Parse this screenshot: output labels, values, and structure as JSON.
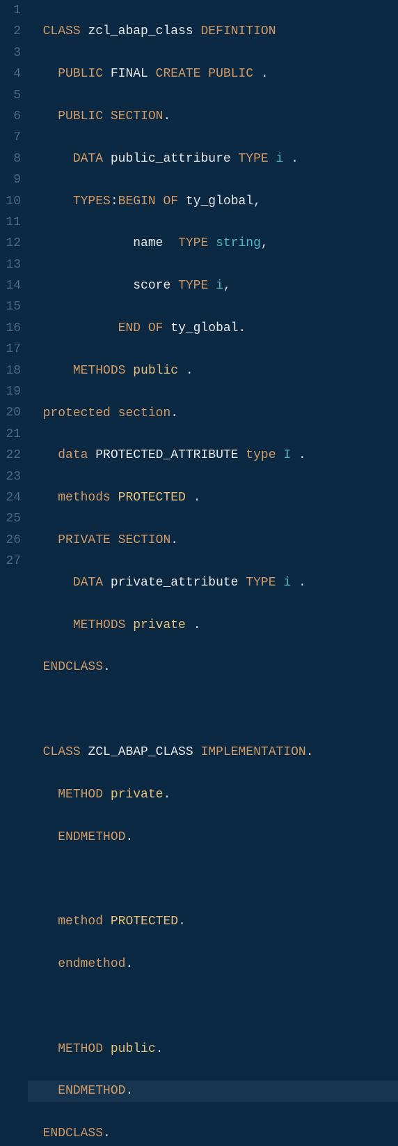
{
  "lines": [
    {
      "num": "1"
    },
    {
      "num": "2"
    },
    {
      "num": "3"
    },
    {
      "num": "4"
    },
    {
      "num": "5"
    },
    {
      "num": "6"
    },
    {
      "num": "7"
    },
    {
      "num": "8"
    },
    {
      "num": "9"
    },
    {
      "num": "10"
    },
    {
      "num": "11"
    },
    {
      "num": "12"
    },
    {
      "num": "13"
    },
    {
      "num": "14"
    },
    {
      "num": "15"
    },
    {
      "num": "16"
    },
    {
      "num": "17"
    },
    {
      "num": "18"
    },
    {
      "num": "19"
    },
    {
      "num": "20"
    },
    {
      "num": "21"
    },
    {
      "num": "22"
    },
    {
      "num": "23"
    },
    {
      "num": "24"
    },
    {
      "num": "25"
    },
    {
      "num": "26"
    },
    {
      "num": "27"
    }
  ],
  "tokens": {
    "l1": {
      "t1": "CLASS",
      "t2": "zcl_abap_class",
      "t3": "DEFINITION"
    },
    "l2": {
      "t1": "PUBLIC",
      "t2": "FINAL",
      "t3": "CREATE",
      "t4": "PUBLIC",
      "t5": "."
    },
    "l3": {
      "t1": "PUBLIC",
      "t2": "SECTION",
      "t3": "."
    },
    "l4": {
      "t1": "DATA",
      "t2": "public_attribure",
      "t3": "TYPE",
      "t4": "i",
      "t5": "."
    },
    "l5": {
      "t1": "TYPES",
      "t2": ":",
      "t3": "BEGIN",
      "t4": "OF",
      "t5": "ty_global",
      "t6": ","
    },
    "l6": {
      "t1": "name",
      "t2": "TYPE",
      "t3": "string",
      "t4": ","
    },
    "l7": {
      "t1": "score",
      "t2": "TYPE",
      "t3": "i",
      "t4": ","
    },
    "l8": {
      "t1": "END",
      "t2": "OF",
      "t3": "ty_global",
      "t4": "."
    },
    "l9": {
      "t1": "METHODS",
      "t2": "public",
      "t3": "."
    },
    "l10": {
      "t1": "protected",
      "t2": "section",
      "t3": "."
    },
    "l11": {
      "t1": "data",
      "t2": "PROTECTED_ATTRIBUTE",
      "t3": "type",
      "t4": "I",
      "t5": "."
    },
    "l12": {
      "t1": "methods",
      "t2": "PROTECTED",
      "t3": "."
    },
    "l13": {
      "t1": "PRIVATE",
      "t2": "SECTION",
      "t3": "."
    },
    "l14": {
      "t1": "DATA",
      "t2": "private_attribute",
      "t3": "TYPE",
      "t4": "i",
      "t5": "."
    },
    "l15": {
      "t1": "METHODS",
      "t2": "private",
      "t3": "."
    },
    "l16": {
      "t1": "ENDCLASS",
      "t2": "."
    },
    "l18": {
      "t1": "CLASS",
      "t2": "ZCL_ABAP_CLASS",
      "t3": "IMPLEMENTATION",
      "t4": "."
    },
    "l19": {
      "t1": "METHOD",
      "t2": "private",
      "t3": "."
    },
    "l20": {
      "t1": "ENDMETHOD",
      "t2": "."
    },
    "l22": {
      "t1": "method",
      "t2": "PROTECTED",
      "t3": "."
    },
    "l23": {
      "t1": "endmethod",
      "t2": "."
    },
    "l25": {
      "t1": "METHOD",
      "t2": "public",
      "t3": "."
    },
    "l26": {
      "t1": "ENDMETHOD",
      "t2": "."
    },
    "l27": {
      "t1": "ENDCLASS",
      "t2": "."
    }
  }
}
